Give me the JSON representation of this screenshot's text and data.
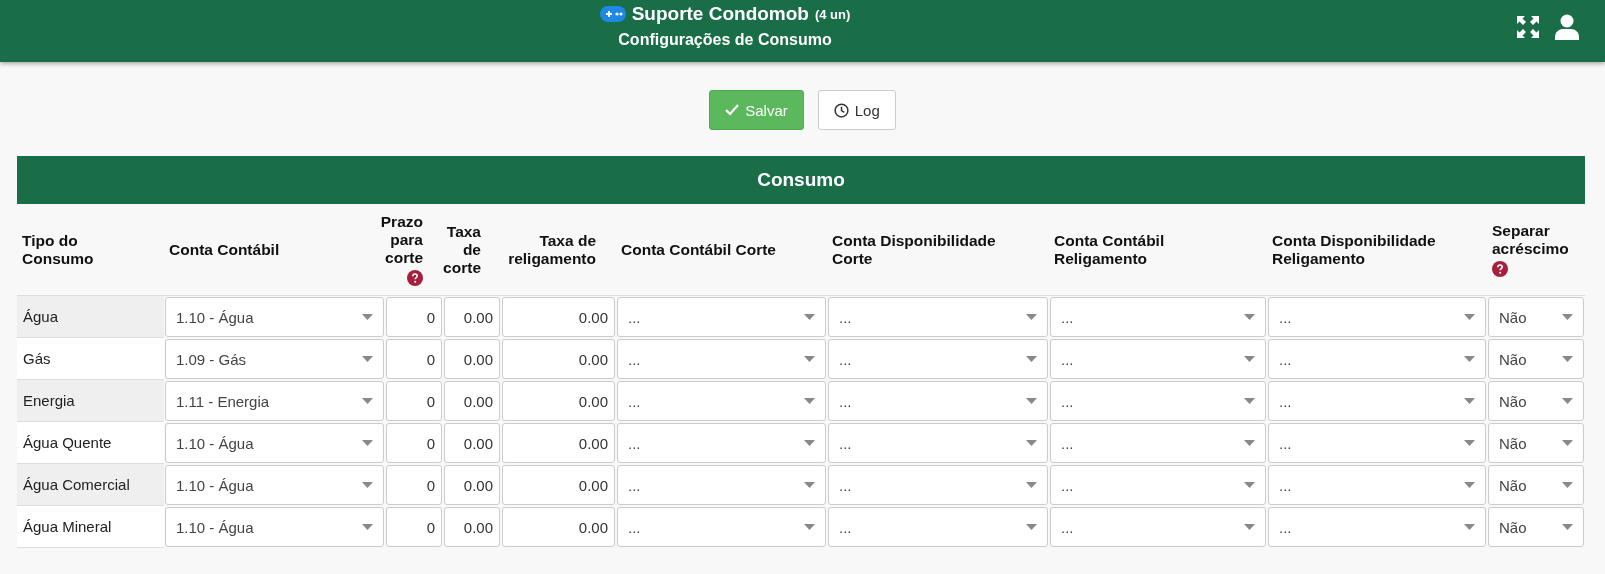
{
  "header": {
    "title": "Suporte Condomob",
    "count": "(4 un)",
    "subtitle": "Configurações de Consumo"
  },
  "actions": [
    {
      "kind": "save",
      "label": "Salvar"
    },
    {
      "kind": "log",
      "label": "Log"
    }
  ],
  "section": {
    "title": "Consumo"
  },
  "columns": [
    {
      "label": "Tipo do Consumo",
      "kind": "text",
      "help": false
    },
    {
      "label": "Conta Contábil",
      "kind": "select",
      "help": false
    },
    {
      "label": "Prazo para corte",
      "kind": "number",
      "help": true
    },
    {
      "label": "Taxa de corte",
      "kind": "number",
      "help": false
    },
    {
      "label": "Taxa de religamento",
      "kind": "number",
      "help": false
    },
    {
      "label": "Conta Contábil Corte",
      "kind": "select",
      "help": false
    },
    {
      "label": "Conta Disponibilidade Corte",
      "kind": "select",
      "help": false
    },
    {
      "label": "Conta Contábil Religamento",
      "kind": "select",
      "help": false
    },
    {
      "label": "Conta Disponibilidade Religamento",
      "kind": "select",
      "help": false
    },
    {
      "label": "Separar acréscimo",
      "kind": "select",
      "help": true
    }
  ],
  "rows": [
    {
      "cells": [
        "Água",
        "1.10 - Água",
        "0",
        "0.00",
        "0.00",
        "...",
        "...",
        "...",
        "...",
        "Não"
      ]
    },
    {
      "cells": [
        "Gás",
        "1.09 - Gás",
        "0",
        "0.00",
        "0.00",
        "...",
        "...",
        "...",
        "...",
        "Não"
      ]
    },
    {
      "cells": [
        "Energia",
        "1.11 - Energia",
        "0",
        "0.00",
        "0.00",
        "...",
        "...",
        "...",
        "...",
        "Não"
      ]
    },
    {
      "cells": [
        "Água Quente",
        "1.10 - Água",
        "0",
        "0.00",
        "0.00",
        "...",
        "...",
        "...",
        "...",
        "Não"
      ]
    },
    {
      "cells": [
        "Água Comercial",
        "1.10 - Água",
        "0",
        "0.00",
        "0.00",
        "...",
        "...",
        "...",
        "...",
        "Não"
      ]
    },
    {
      "cells": [
        "Água Mineral",
        "1.10 - Água",
        "0",
        "0.00",
        "0.00",
        "...",
        "...",
        "...",
        "...",
        "Não"
      ]
    }
  ]
}
